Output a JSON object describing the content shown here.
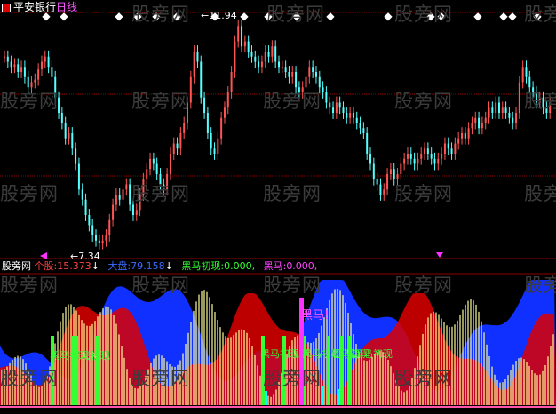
{
  "header": {
    "stock_name": "平安银行",
    "period": "日线"
  },
  "price_panel": {
    "high_label": "11.94",
    "low_label": "7.34"
  },
  "indicator_header": {
    "title": "股旁网",
    "items": [
      {
        "label": "个股:",
        "value": "15.373",
        "arrow": "↓"
      },
      {
        "label": "大盘:",
        "value": "79.158",
        "arrow": "↓"
      },
      {
        "label": "黑马初现:",
        "value": "0.000,"
      },
      {
        "label": "黑马:",
        "value": "0.000,"
      }
    ]
  },
  "annotations": {
    "black_horse": "黑马!",
    "black_horse_emerge": "黑马初现"
  },
  "watermark": "股旁网",
  "colors": {
    "background": "#000000",
    "grid_red": "#8b0000",
    "up_candle": "#ff5555",
    "down_candle": "#55ffff",
    "yellow_bars": "#ffff99",
    "red_area": "#dd0000",
    "blue_area": "#1030ff",
    "green_bars": "#33ff33",
    "magenta": "#ff33ff",
    "cyan": "#00ffff"
  },
  "chart_data": {
    "type": "candlestick",
    "close": [
      11.1,
      11.0,
      10.9,
      10.95,
      10.8,
      10.9,
      10.7,
      10.5,
      10.6,
      10.65,
      10.85,
      11.0,
      11.1,
      10.9,
      10.7,
      10.3,
      10.0,
      9.8,
      9.5,
      9.6,
      9.3,
      9.0,
      8.5,
      8.3,
      8.0,
      7.8,
      7.6,
      7.5,
      7.45,
      7.5,
      7.6,
      7.9,
      8.2,
      8.4,
      8.3,
      8.5,
      8.6,
      8.2,
      8.0,
      8.1,
      8.4,
      8.7,
      8.9,
      9.1,
      9.0,
      8.8,
      8.6,
      8.5,
      8.8,
      9.2,
      9.4,
      9.3,
      9.6,
      9.8,
      10.2,
      10.7,
      11.2,
      11.0,
      10.3,
      10.0,
      9.6,
      9.3,
      9.2,
      9.5,
      9.9,
      10.1,
      10.4,
      10.8,
      11.4,
      11.7,
      11.3,
      11.4,
      11.2,
      11.1,
      11.0,
      10.9,
      11.0,
      11.2,
      11.1,
      11.3,
      11.0,
      10.9,
      10.9,
      10.8,
      10.7,
      10.8,
      10.5,
      10.4,
      10.5,
      10.7,
      10.9,
      10.8,
      10.7,
      10.5,
      10.4,
      10.2,
      10.1,
      10.0,
      10.2,
      10.1,
      10.0,
      9.9,
      10.0,
      9.9,
      9.8,
      9.7,
      9.6,
      9.2,
      9.0,
      8.7,
      8.6,
      8.4,
      8.5,
      8.8,
      8.9,
      8.7,
      8.8,
      9.0,
      9.1,
      9.2,
      9.1,
      9.0,
      9.1,
      9.2,
      9.3,
      9.2,
      9.1,
      9.0,
      9.1,
      9.2,
      9.4,
      9.3,
      9.2,
      9.4,
      9.5,
      9.6,
      9.5,
      9.7,
      9.8,
      9.9,
      9.7,
      9.8,
      9.9,
      10.1,
      10.0,
      10.2,
      10.0,
      10.1,
      10.0,
      9.9,
      9.8,
      10.0,
      10.6,
      10.9,
      10.7,
      10.5,
      10.4,
      10.2,
      10.3,
      10.1,
      10.0,
      10.2
    ],
    "ylim": [
      7.2,
      12.0
    ],
    "high_label_value": 11.94,
    "low_label_value": 7.34
  }
}
